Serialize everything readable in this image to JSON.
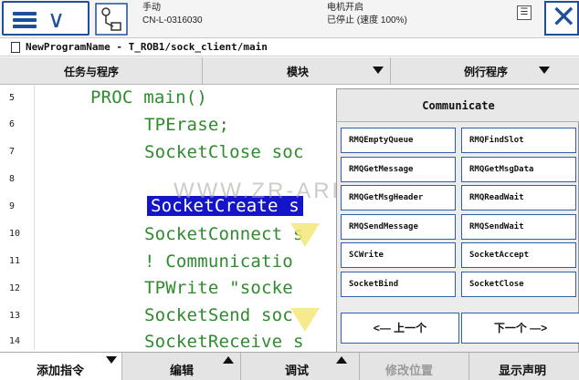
{
  "topbar": {
    "mode": "手动",
    "controller": "CN-L-0316030",
    "motors": "电机开启",
    "state": "已停止 (速度 100%)"
  },
  "title_line": "NewProgramName - T_ROB1/sock_client/main",
  "tabs": [
    {
      "label": "任务与程序"
    },
    {
      "label": "模块"
    },
    {
      "label": "例行程序"
    }
  ],
  "editor": {
    "line_numbers": [
      "5",
      "6",
      "7",
      "8",
      "9",
      "10",
      "11",
      "12",
      "13",
      "14"
    ],
    "lines": [
      "PROC main()",
      "TPErase;",
      "SocketClose soc",
      "",
      "SocketCreate s",
      "SocketConnect s",
      "! Communicatio",
      "TPWrite \"socke",
      "SocketSend soc",
      "SocketReceive s"
    ],
    "selected_line": 4,
    "watermark": "WWW.ZR-ARB.COM"
  },
  "panel": {
    "title": "Communicate",
    "instructions": [
      "RMQEmptyQueue",
      "RMQFindSlot",
      "RMQGetMessage",
      "RMQGetMsgData",
      "RMQGetMsgHeader",
      "RMQReadWait",
      "RMQSendMessage",
      "RMQSendWait",
      "SCWrite",
      "SocketAccept",
      "SocketBind",
      "SocketClose"
    ],
    "prev_label": "<— 上一个",
    "next_label": "下一个 —>"
  },
  "bottombar": [
    {
      "label": "添加指令"
    },
    {
      "label": "编辑"
    },
    {
      "label": "调试"
    },
    {
      "label": "修改位置"
    },
    {
      "label": "显示声明"
    }
  ],
  "colors": {
    "accent": "#1e4f9a",
    "code": "#2e8b2e",
    "selection": "#1414c8"
  },
  "icons": [
    "menu-icon",
    "chevron-down-icon",
    "robot-status-icon",
    "quickset-icon",
    "close-icon"
  ]
}
